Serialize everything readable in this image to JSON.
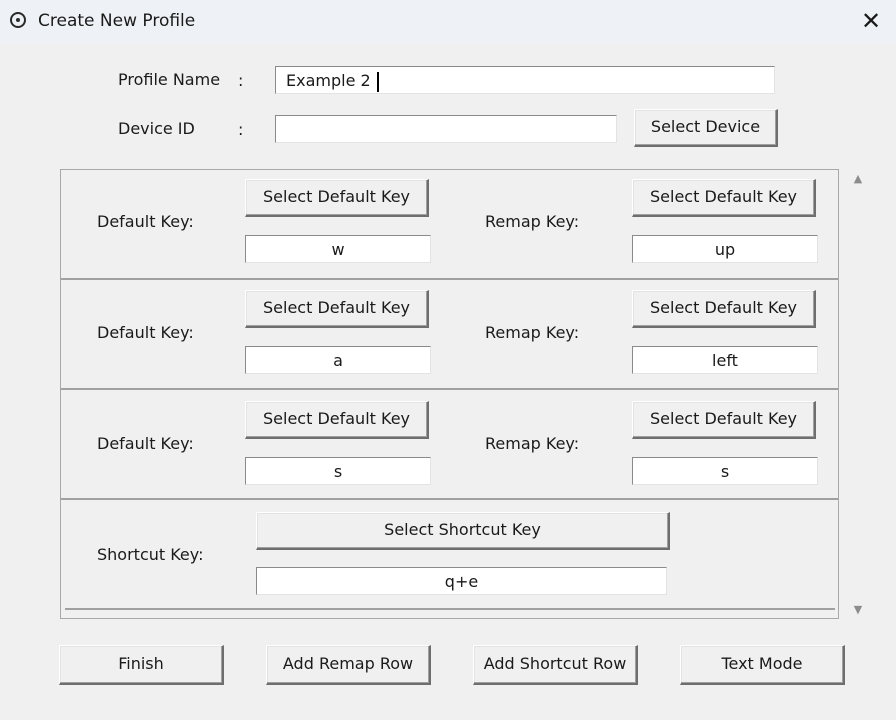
{
  "window": {
    "title": "Create New Profile",
    "close_symbol": "✕"
  },
  "form": {
    "profile_name_label": "Profile Name",
    "profile_name_colon": ":",
    "profile_name_value": "Example 2",
    "device_id_label": "Device ID",
    "device_id_colon": ":",
    "device_id_value": "",
    "select_device_label": "Select Device"
  },
  "rows": [
    {
      "default_label": "Default Key:",
      "select_default_label": "Select Default Key",
      "default_value": "w",
      "remap_label": "Remap Key:",
      "select_remap_label": "Select Default Key",
      "remap_value": "up"
    },
    {
      "default_label": "Default Key:",
      "select_default_label": "Select Default Key",
      "default_value": "a",
      "remap_label": "Remap Key:",
      "select_remap_label": "Select Default Key",
      "remap_value": "left"
    },
    {
      "default_label": "Default Key:",
      "select_default_label": "Select Default Key",
      "default_value": "s",
      "remap_label": "Remap Key:",
      "select_remap_label": "Select Default Key",
      "remap_value": "s"
    }
  ],
  "shortcut_row": {
    "label": "Shortcut Key:",
    "select_label": "Select Shortcut Key",
    "value": "q+e"
  },
  "scrollbar": {
    "up_symbol": "▲",
    "down_symbol": "▼"
  },
  "footer": {
    "finish_label": "Finish",
    "add_remap_label": "Add Remap Row",
    "add_shortcut_label": "Add Shortcut Row",
    "text_mode_label": "Text Mode"
  }
}
